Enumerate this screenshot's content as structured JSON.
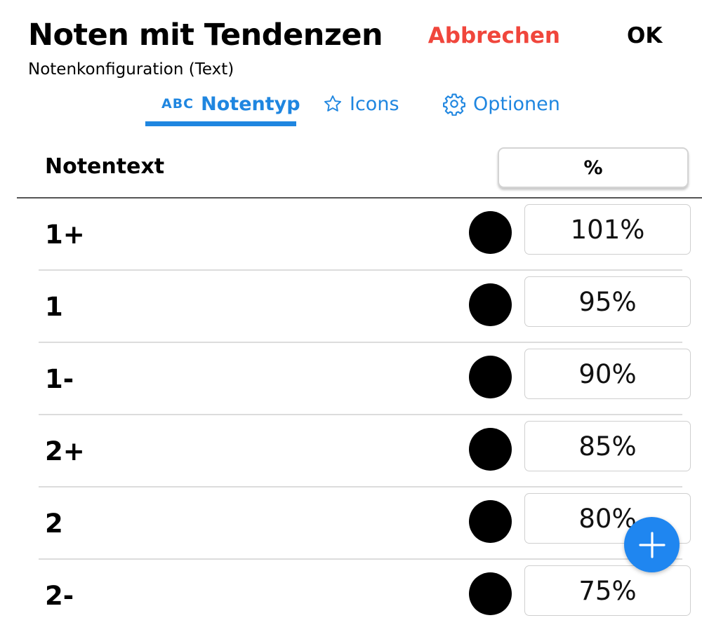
{
  "header": {
    "title": "Noten mit Tendenzen",
    "subtitle": "Notenkonfiguration (Text)",
    "cancel_label": "Abbrechen",
    "ok_label": "OK"
  },
  "tabs": [
    {
      "label": "Notentyp",
      "icon": "abc-icon",
      "icon_text": "ABC",
      "active": true
    },
    {
      "label": "Icons",
      "icon": "star-icon",
      "active": false
    },
    {
      "label": "Optionen",
      "icon": "gear-icon",
      "active": false
    }
  ],
  "table": {
    "column_header": "Notentext",
    "percent_header_label": "%",
    "rows": [
      {
        "label": "1+",
        "percent": "101%"
      },
      {
        "label": "1",
        "percent": "95%"
      },
      {
        "label": "1-",
        "percent": "90%"
      },
      {
        "label": "2+",
        "percent": "85%"
      },
      {
        "label": "2",
        "percent": "80%"
      },
      {
        "label": "2-",
        "percent": "75%"
      }
    ]
  },
  "fab": {
    "icon": "plus-icon"
  },
  "colors": {
    "accent": "#1f86e0",
    "cancel": "#f0463c",
    "fab": "#1f86f0",
    "grade_color": "#000000"
  }
}
